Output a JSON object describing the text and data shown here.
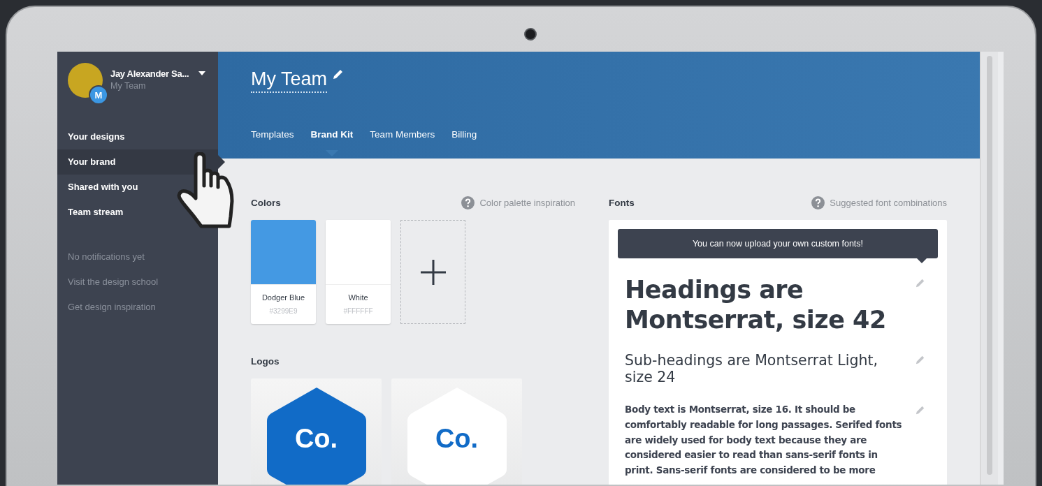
{
  "sidebar": {
    "user": {
      "name": "Jay Alexander Sa...",
      "team": "My Team",
      "badge": "M"
    },
    "nav": [
      {
        "label": "Your designs",
        "selected": false
      },
      {
        "label": "Your brand",
        "selected": true
      },
      {
        "label": "Shared with you",
        "selected": false
      },
      {
        "label": "Team stream",
        "selected": false
      }
    ],
    "links": [
      "No notifications yet",
      "Visit the design school",
      "Get design inspiration"
    ]
  },
  "header": {
    "title": "My Team",
    "tabs": [
      {
        "label": "Templates",
        "selected": false
      },
      {
        "label": "Brand Kit",
        "selected": true
      },
      {
        "label": "Team Members",
        "selected": false
      },
      {
        "label": "Billing",
        "selected": false
      }
    ]
  },
  "colors": {
    "title": "Colors",
    "help": "Color palette inspiration",
    "swatches": [
      {
        "name": "Dodger Blue",
        "hex": "#3299E9",
        "color": "#4499e3"
      },
      {
        "name": "White",
        "hex": "#FFFFFF",
        "color": "#ffffff"
      }
    ]
  },
  "logos": {
    "title": "Logos",
    "items": [
      {
        "text": "Co.",
        "kind": "filled"
      },
      {
        "text": "Co.",
        "kind": "outline"
      }
    ]
  },
  "fonts": {
    "title": "Fonts",
    "help": "Suggested font combinations",
    "banner": "You can now upload your own custom fonts!",
    "samples": [
      {
        "kind": "heading",
        "text": "Headings are Montserrat, size 42"
      },
      {
        "kind": "subheading",
        "text": "Sub-headings are Montserrat Light, size 24"
      },
      {
        "kind": "body",
        "text": "Body text is Montserrat, size 16. It should be comfortably readable for long passages. Serifed fonts are widely used for body text because they are considered easier to read than sans-serif fonts in print. Sans-serif fonts are considered to be more"
      }
    ]
  }
}
